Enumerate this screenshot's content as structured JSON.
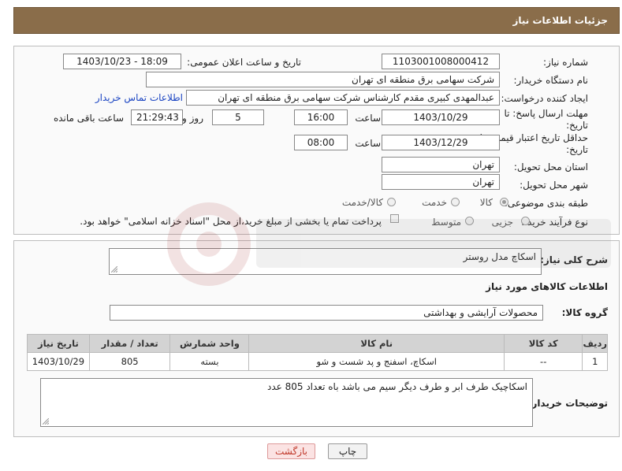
{
  "header": {
    "title": "جزئیات اطلاعات نیاز"
  },
  "form": {
    "need_number_label": "شماره نیاز:",
    "need_number": "1103001008000412",
    "announce_label": "تاریخ و ساعت اعلان عمومی:",
    "announce_value": "1403/10/23 - 18:09",
    "buyer_org_label": "نام دستگاه خریدار:",
    "buyer_org": "شرکت سهامی برق منطقه ای تهران",
    "creator_label": "ایجاد کننده درخواست:",
    "creator": "عبدالمهدی کبیری مقدم کارشناس شرکت سهامی برق منطقه ای تهران",
    "contact_link": "اطلاعات تماس خریدار",
    "reply_deadline_label_1": "مهلت ارسال پاسخ: تا",
    "reply_deadline_label_2": "تاریخ:",
    "reply_date": "1403/10/29",
    "time_label": "ساعت",
    "reply_time": "16:00",
    "days_value": "5",
    "days_label": "روز و",
    "remaining_value": "21:29:43",
    "remaining_label": "ساعت باقی مانده",
    "price_deadline_label_1": "حداقل تاریخ اعتبار قیمت: تا",
    "price_deadline_label_2": "تاریخ:",
    "price_date": "1403/12/29",
    "price_time": "08:00",
    "province_label": "استان محل تحویل:",
    "province": "تهران",
    "city_label": "شهر محل تحویل:",
    "city": "تهران",
    "category_label": "طبقه بندی موضوعی:",
    "category_options": [
      "کالا",
      "خدمت",
      "کالا/خدمت"
    ],
    "process_label": "نوع فرآیند خرید :",
    "process_options": [
      "جزیی",
      "متوسط"
    ],
    "payment_note": "پرداخت تمام یا بخشی از مبلغ خرید،از محل \"اسناد خزانه اسلامی\" خواهد بود."
  },
  "details": {
    "summary_label": "شرح کلی نیاز:",
    "summary": "اسکاچ مدل روستر",
    "goods_info_title": "اطلاعات کالاهای مورد نیاز",
    "group_label": "گروه کالا:",
    "group_value": "محصولات آرایشی و بهداشتی",
    "table": {
      "headers": [
        "ردیف",
        "کد کالا",
        "نام کالا",
        "واحد شمارش",
        "تعداد / مقدار",
        "تاریخ نیاز"
      ],
      "rows": [
        [
          "1",
          "--",
          "اسکاچ، اسفنج و پد شست و شو",
          "بسته",
          "805",
          "1403/10/29"
        ]
      ]
    },
    "buyer_notes_label": "توضیحات خریدار:",
    "buyer_notes": "اسکاچیک طرف ابر و طرف دیگر سیم می باشد باه تعداد 805 عدد"
  },
  "buttons": {
    "print": "چاپ",
    "back": "بازگشت"
  },
  "colors": {
    "header_bg": "#8a6d4a",
    "link": "#1a44c2",
    "back_button_bg": "#fbe3e3"
  }
}
